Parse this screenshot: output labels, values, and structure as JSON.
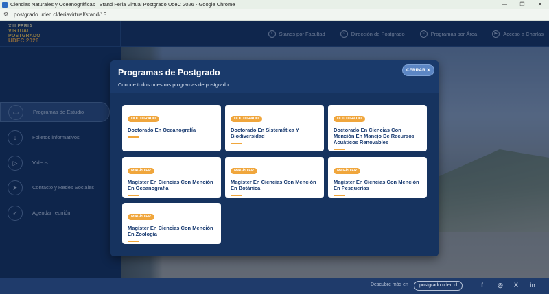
{
  "window": {
    "title": "Ciencias Naturales y Oceanográficas | Stand Feria Virtual Postgrado UdeC 2026 - Google Chrome",
    "url": "postgrado.udec.cl/feriavirtual/stand/15"
  },
  "logo": {
    "line1": "XIII FERIA",
    "line2": "VIRTUAL",
    "line3": "POSTGRADO",
    "line4": "UDEC 2026"
  },
  "nav": [
    {
      "label": "Stands por Facultad",
      "icon": "search-icon"
    },
    {
      "label": "Dirección de Postgrado",
      "icon": "home-icon"
    },
    {
      "label": "Programas por Área",
      "icon": "document-icon"
    },
    {
      "label": "Acceso a Charlas",
      "icon": "video-icon"
    }
  ],
  "sidebar": [
    {
      "label": "Programas de Estudio",
      "icon": "chat-icon"
    },
    {
      "label": "Folletos informativos",
      "icon": "download-icon"
    },
    {
      "label": "Videos",
      "icon": "play-icon"
    },
    {
      "label": "Contacto y Redes Sociales",
      "icon": "send-icon"
    },
    {
      "label": "Agendar reunión",
      "icon": "check-icon"
    }
  ],
  "modal": {
    "title": "Programas de Postgrado",
    "subtitle": "Conoce todos nuestros programas de postgrado.",
    "close_label": "CERRAR",
    "programs": [
      {
        "badge": "DOCTORADO",
        "title": "Doctorado En Oceanografía"
      },
      {
        "badge": "DOCTORADO",
        "title": "Doctorado En Sistemática Y Biodiversidad"
      },
      {
        "badge": "DOCTORADO",
        "title": "Doctorado En Ciencias Con Mención En Manejo De Recursos Acuáticos Renovables"
      },
      {
        "badge": "MAGÍSTER",
        "title": "Magíster En Ciencias Con Mención En Oceanografía"
      },
      {
        "badge": "MAGÍSTER",
        "title": "Magíster En Ciencias Con Mención En Botánica"
      },
      {
        "badge": "MAGÍSTER",
        "title": "Magíster En Ciencias Con Mención En Pesquerías"
      },
      {
        "badge": "MAGÍSTER",
        "title": "Magíster En Ciencias Con Mención En Zoología"
      }
    ]
  },
  "footer": {
    "discover": "Descubre más en",
    "site": "postgrado.udec.cl",
    "social": [
      {
        "label": "f",
        "icon": "facebook-icon"
      },
      {
        "label": "◎",
        "icon": "instagram-icon"
      },
      {
        "label": "X",
        "icon": "x-icon"
      },
      {
        "label": "in",
        "icon": "linkedin-icon"
      }
    ]
  }
}
